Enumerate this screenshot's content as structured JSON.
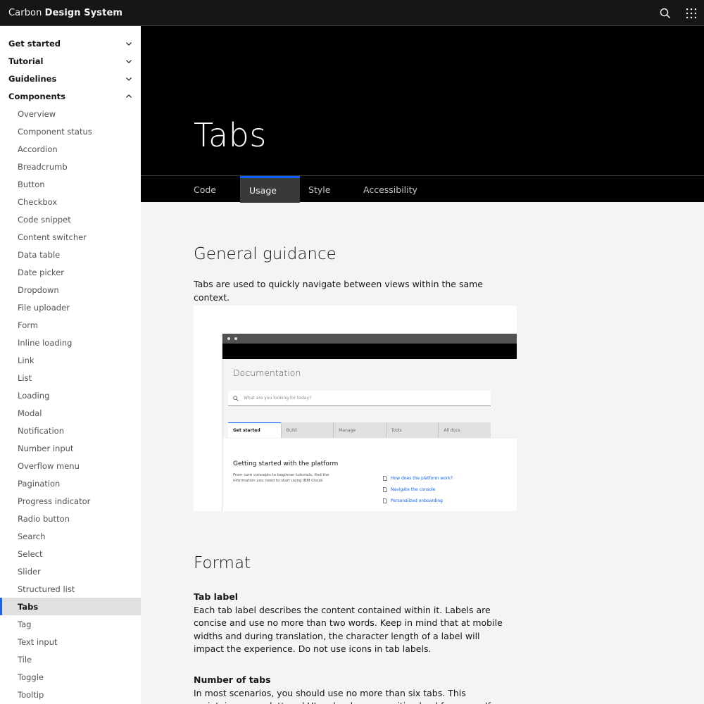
{
  "header": {
    "brand_light": "Carbon",
    "brand_bold": "Design System",
    "search_icon": "search-icon",
    "switcher_icon": "app-switcher-icon"
  },
  "sidebar": {
    "categories": [
      {
        "label": "Get started",
        "expanded": false
      },
      {
        "label": "Tutorial",
        "expanded": false
      },
      {
        "label": "Guidelines",
        "expanded": false
      },
      {
        "label": "Components",
        "expanded": true
      }
    ],
    "components": [
      "Overview",
      "Component status",
      "Accordion",
      "Breadcrumb",
      "Button",
      "Checkbox",
      "Code snippet",
      "Content switcher",
      "Data table",
      "Date picker",
      "Dropdown",
      "File uploader",
      "Form",
      "Inline loading",
      "Link",
      "List",
      "Loading",
      "Modal",
      "Notification",
      "Number input",
      "Overflow menu",
      "Pagination",
      "Progress indicator",
      "Radio button",
      "Search",
      "Select",
      "Slider",
      "Structured list",
      "Tabs",
      "Tag",
      "Text input",
      "Tile",
      "Toggle",
      "Tooltip"
    ],
    "active_item": "Tabs"
  },
  "hero": {
    "title": "Tabs"
  },
  "tabs": {
    "items": [
      "Code",
      "Usage",
      "Style",
      "Accessibility"
    ],
    "selected": "Usage"
  },
  "content": {
    "general_heading": "General guidance",
    "general_text": "Tabs are used to quickly navigate between views within the same context.",
    "illustration": {
      "doc_title": "Documentation",
      "search_placeholder": "What are you looking for today?",
      "tabs": [
        "Get started",
        "Build",
        "Manage",
        "Tools",
        "All docs"
      ],
      "section_title": "Getting started with the platform",
      "section_desc": "From core concepts to beginner tutorials, find the information you need to start using IBM Cloud.",
      "links": [
        "How does the platform work?",
        "Navigate the console",
        "Personalized onboarding"
      ]
    },
    "format_heading": "Format",
    "tab_label_heading": "Tab label",
    "tab_label_text": "Each tab label describes the content contained within it. Labels are concise and use no more than two words. Keep in mind that at mobile widths and during translation, the character length of a label will impact the experience. Do not use icons in tab labels.",
    "num_tabs_heading": "Number of tabs",
    "num_tabs_text": "In most scenarios, you should use no more than six tabs. This maintains an uncluttered UI and reduces cognitive load for users. If more than six tabs are needed, consider other navigation patterns."
  },
  "colors": {
    "accent": "#0f62fe",
    "header_bg": "#161616",
    "hero_bg": "#000000",
    "page_bg": "#f4f4f4"
  }
}
